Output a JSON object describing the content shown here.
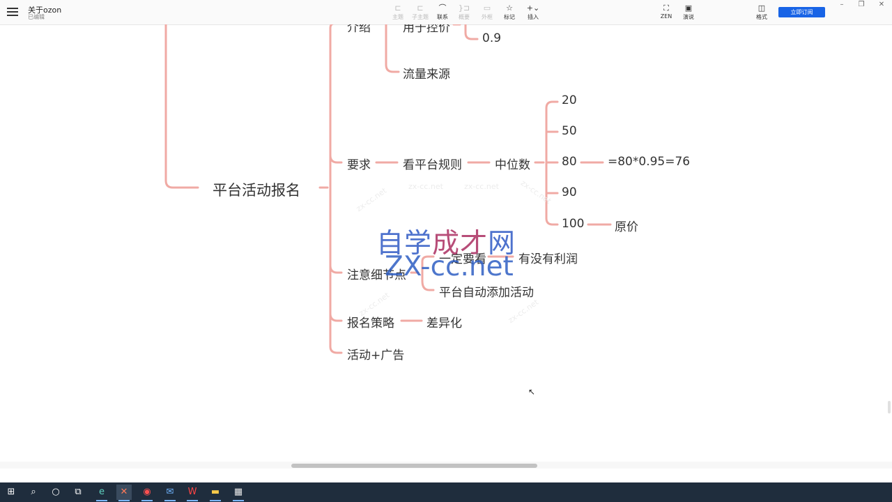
{
  "topbar": {
    "title": "关于ozon",
    "subtitle": "已编辑",
    "tools": [
      {
        "label": "主题",
        "icon": "⊏"
      },
      {
        "label": "子主题",
        "icon": "⊏"
      },
      {
        "label": "联系",
        "icon": "⌒"
      },
      {
        "label": "概要",
        "icon": "}⊐"
      },
      {
        "label": "外框",
        "icon": "▭"
      },
      {
        "label": "标记",
        "icon": "☆"
      },
      {
        "label": "插入",
        "icon": "+⌄"
      }
    ],
    "right_tools": [
      {
        "label": "ZEN",
        "icon": "⛶"
      },
      {
        "label": "演说",
        "icon": "▣"
      },
      {
        "label": "格式",
        "icon": "◫"
      }
    ],
    "subscribe_label": "立即订阅"
  },
  "mindmap": {
    "root": "平台活动报名",
    "intro": {
      "label": "介绍",
      "child1": "用于控价",
      "child1_value": "0.9",
      "child2": "流量来源"
    },
    "requirement": {
      "label": "要求",
      "rule": "看平台规则",
      "median": "中位数",
      "values": [
        "20",
        "50",
        "80",
        "90",
        "100"
      ],
      "calc": "=80*0.95=76",
      "original": "原价"
    },
    "details": {
      "label": "注意细节点",
      "child1": "一定要看",
      "child1_sub": "有没有利润",
      "child2": "平台自动添加活动"
    },
    "strategy": {
      "label": "报名策略",
      "child": "差异化"
    },
    "ads": {
      "label": "活动+广告"
    }
  },
  "watermark": {
    "line1_blue": "自学",
    "line1_red": "成才",
    "line1_blue2": "网",
    "line2": "ZX-cc.net",
    "faint": "zx-cc.net"
  },
  "colors": {
    "branch": "#f0aaa4",
    "accent": "#1864e6",
    "taskbar": "#1f2d3d"
  },
  "taskbar": {
    "items": [
      {
        "name": "start-button",
        "icon": "⊞"
      },
      {
        "name": "search-icon",
        "icon": "⌕"
      },
      {
        "name": "cortana-icon",
        "icon": "○"
      },
      {
        "name": "task-view-icon",
        "icon": "⧉"
      },
      {
        "name": "edge-icon",
        "icon": "e"
      },
      {
        "name": "xmind-icon",
        "icon": "✕"
      },
      {
        "name": "recorder-icon",
        "icon": "◉"
      },
      {
        "name": "mail-icon",
        "icon": "✉"
      },
      {
        "name": "wps-icon",
        "icon": "W"
      },
      {
        "name": "explorer-icon",
        "icon": "▬"
      },
      {
        "name": "calculator-icon",
        "icon": "▦"
      }
    ]
  }
}
